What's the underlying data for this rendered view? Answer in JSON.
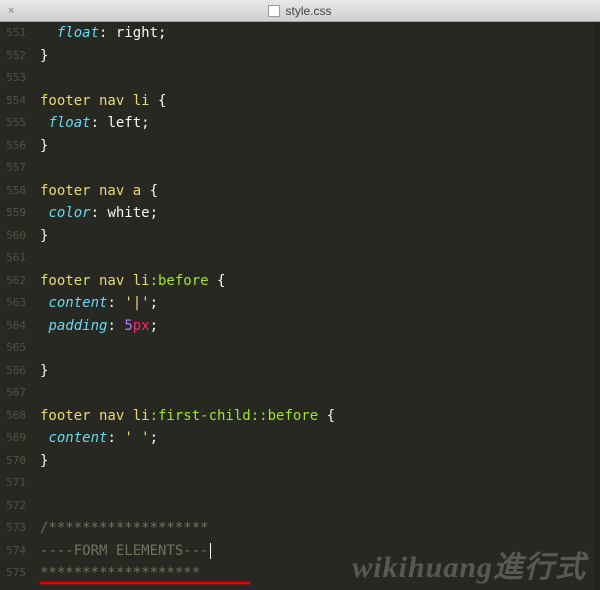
{
  "titlebar": {
    "filename": "style.css"
  },
  "gutter": {
    "start": 551,
    "end": 575
  },
  "code": {
    "lines": [
      {
        "segs": [
          {
            "t": "  ",
            "c": ""
          },
          {
            "t": "float",
            "c": "c-prop"
          },
          {
            "t": ": ",
            "c": "c-punc"
          },
          {
            "t": "right",
            "c": "c-val"
          },
          {
            "t": ";",
            "c": "c-punc"
          }
        ]
      },
      {
        "segs": [
          {
            "t": "}",
            "c": "c-punc"
          }
        ]
      },
      {
        "segs": [
          {
            "t": "",
            "c": ""
          }
        ]
      },
      {
        "segs": [
          {
            "t": "footer nav li ",
            "c": "c-sel"
          },
          {
            "t": "{",
            "c": "c-punc"
          }
        ]
      },
      {
        "segs": [
          {
            "t": " ",
            "c": ""
          },
          {
            "t": "float",
            "c": "c-prop"
          },
          {
            "t": ": ",
            "c": "c-punc"
          },
          {
            "t": "left",
            "c": "c-val"
          },
          {
            "t": ";",
            "c": "c-punc"
          }
        ]
      },
      {
        "segs": [
          {
            "t": "}",
            "c": "c-punc"
          }
        ]
      },
      {
        "segs": [
          {
            "t": "",
            "c": ""
          }
        ]
      },
      {
        "segs": [
          {
            "t": "footer nav a ",
            "c": "c-sel"
          },
          {
            "t": "{",
            "c": "c-punc"
          }
        ]
      },
      {
        "segs": [
          {
            "t": " ",
            "c": ""
          },
          {
            "t": "color",
            "c": "c-prop"
          },
          {
            "t": ": ",
            "c": "c-punc"
          },
          {
            "t": "white",
            "c": "c-val"
          },
          {
            "t": ";",
            "c": "c-punc"
          }
        ]
      },
      {
        "segs": [
          {
            "t": "}",
            "c": "c-punc"
          }
        ]
      },
      {
        "segs": [
          {
            "t": "",
            "c": ""
          }
        ]
      },
      {
        "segs": [
          {
            "t": "footer nav li",
            "c": "c-sel"
          },
          {
            "t": ":before ",
            "c": "c-pseudo"
          },
          {
            "t": "{",
            "c": "c-punc"
          }
        ]
      },
      {
        "segs": [
          {
            "t": " ",
            "c": ""
          },
          {
            "t": "content",
            "c": "c-prop"
          },
          {
            "t": ": ",
            "c": "c-punc"
          },
          {
            "t": "'|'",
            "c": "c-str"
          },
          {
            "t": ";",
            "c": "c-punc"
          }
        ]
      },
      {
        "segs": [
          {
            "t": " ",
            "c": ""
          },
          {
            "t": "padding",
            "c": "c-prop"
          },
          {
            "t": ": ",
            "c": "c-punc"
          },
          {
            "t": "5",
            "c": "c-num"
          },
          {
            "t": "px",
            "c": "c-unit"
          },
          {
            "t": ";",
            "c": "c-punc"
          }
        ]
      },
      {
        "segs": [
          {
            "t": "",
            "c": ""
          }
        ]
      },
      {
        "segs": [
          {
            "t": "}",
            "c": "c-punc"
          }
        ]
      },
      {
        "segs": [
          {
            "t": "",
            "c": ""
          }
        ]
      },
      {
        "segs": [
          {
            "t": "footer nav li",
            "c": "c-sel"
          },
          {
            "t": ":first-child::before ",
            "c": "c-pseudo"
          },
          {
            "t": "{",
            "c": "c-punc"
          }
        ]
      },
      {
        "segs": [
          {
            "t": " ",
            "c": ""
          },
          {
            "t": "content",
            "c": "c-prop"
          },
          {
            "t": ": ",
            "c": "c-punc"
          },
          {
            "t": "' '",
            "c": "c-str"
          },
          {
            "t": ";",
            "c": "c-punc"
          }
        ]
      },
      {
        "segs": [
          {
            "t": "}",
            "c": "c-punc"
          }
        ]
      },
      {
        "segs": [
          {
            "t": "",
            "c": ""
          }
        ]
      },
      {
        "segs": [
          {
            "t": "",
            "c": ""
          }
        ]
      },
      {
        "segs": [
          {
            "t": "/*******************",
            "c": "c-comm"
          }
        ]
      },
      {
        "segs": [
          {
            "t": "----FORM ELEMENTS---",
            "c": "c-comm"
          }
        ],
        "cursor": true
      },
      {
        "segs": [
          {
            "t": "*******************",
            "c": "c-comm"
          }
        ]
      }
    ]
  },
  "watermark": "wikihuang進行式"
}
